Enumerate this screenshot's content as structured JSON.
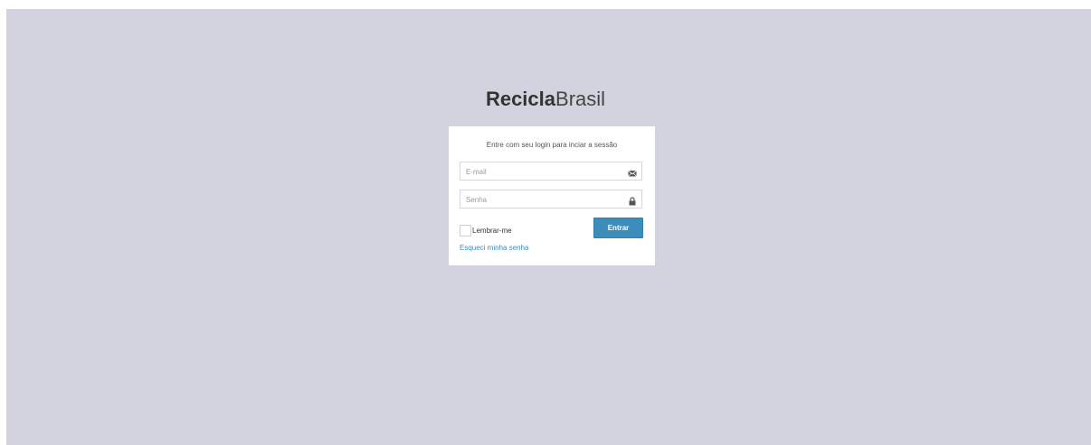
{
  "brand": {
    "bold": "Recicla",
    "light": "Brasil"
  },
  "login": {
    "message": "Entre com seu login para inciar a sessão",
    "email_placeholder": "E-mail",
    "password_placeholder": "Senha",
    "remember_label": "Lembrar-me",
    "submit_label": "Entrar",
    "forgot_label": "Esqueci minha senha"
  },
  "icons": {
    "email": "envelope-icon",
    "password": "lock-icon"
  },
  "colors": {
    "background": "#d2d3de",
    "accent": "#3c8dbc"
  }
}
